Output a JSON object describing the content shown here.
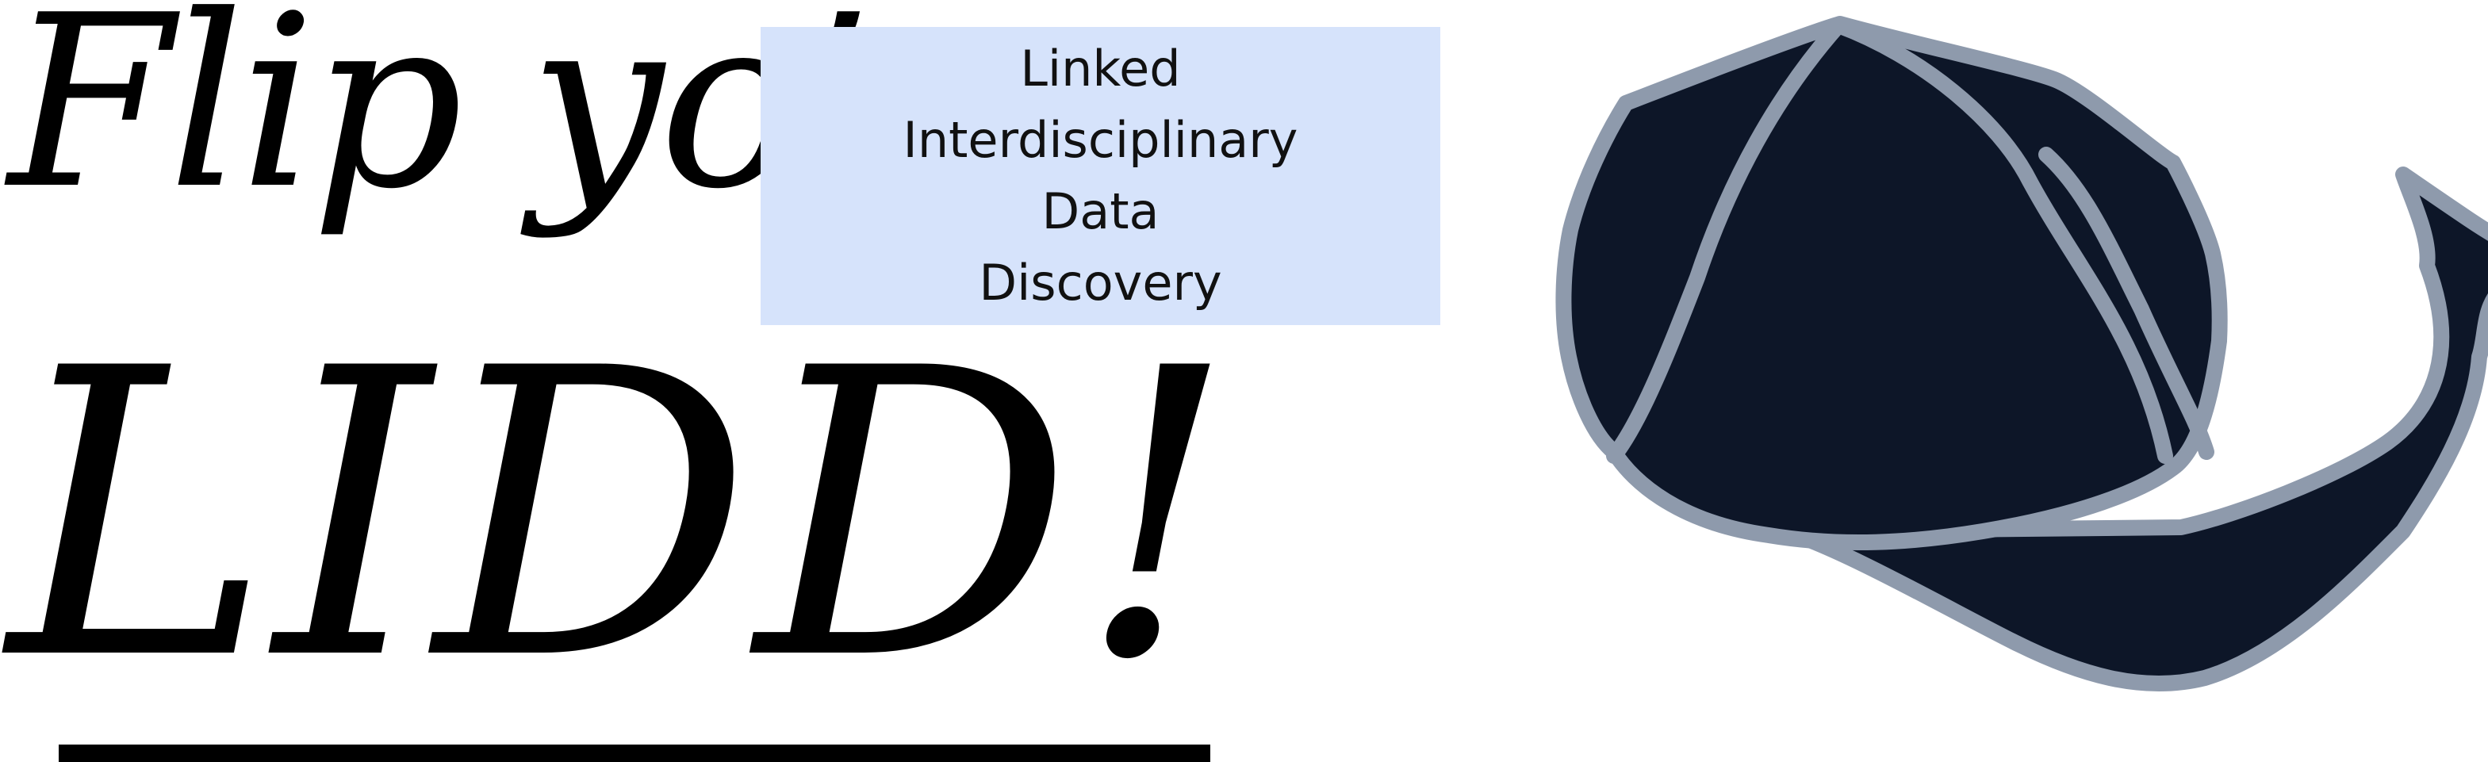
{
  "headline": {
    "line1": "Flip yo’",
    "line2": "LIDD!"
  },
  "acronym": {
    "words": [
      "Linked",
      "Interdisciplinary",
      "Data",
      "Discovery"
    ]
  },
  "colors": {
    "background": "#ffffff",
    "text": "#000000",
    "box_fill": "#d6e3fb",
    "cap_fill": "#0d1628",
    "cap_outline": "#8e9aac"
  },
  "icons": {
    "cap": "baseball-cap-icon"
  }
}
